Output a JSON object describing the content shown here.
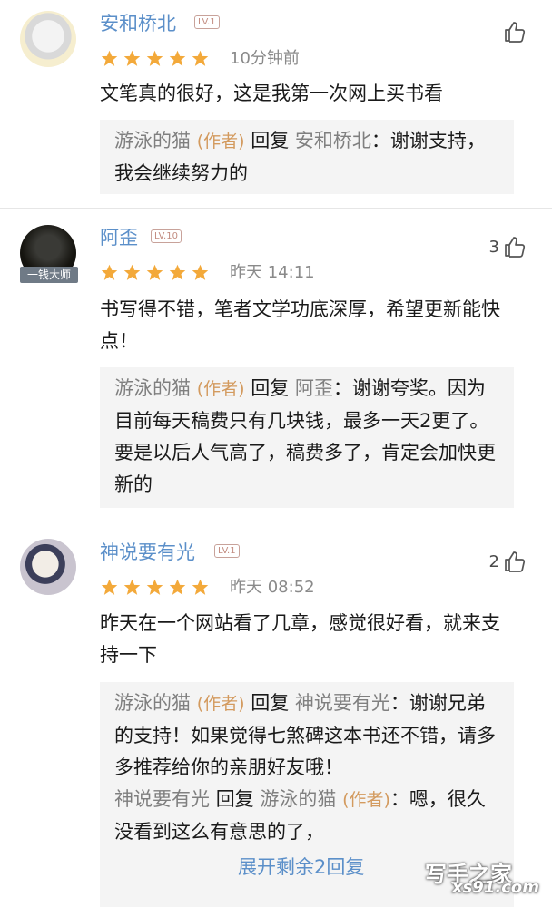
{
  "comments": [
    {
      "name": "安和桥北",
      "level": "LV.1",
      "time": "10分钟前",
      "likes": "",
      "rating": 5,
      "text": "文笔真的很好，这是我第一次网上买书看",
      "reply": {
        "replier": "游泳的猫",
        "author_tag": "(作者)",
        "action": "回复",
        "target": "安和桥北",
        "text": "：谢谢支持，我会继续努力的"
      }
    },
    {
      "name": "阿歪",
      "level": "LV.10",
      "time": "昨天 14:11",
      "likes": "3",
      "rating": 5,
      "avatar_badge": "一钱大师",
      "text": "书写得不错，笔者文学功底深厚，希望更新能快点！",
      "reply": {
        "replier": "游泳的猫",
        "author_tag": "(作者)",
        "action": "回复",
        "target": "阿歪",
        "text": "：谢谢夸奖。因为目前每天稿费只有几块钱，最多一天2更了。要是以后人气高了，稿费多了，肯定会加快更新的"
      }
    },
    {
      "name": "神说要有光",
      "level": "LV.1",
      "time": "昨天 08:52",
      "likes": "2",
      "rating": 5,
      "text": "昨天在一个网站看了几章，感觉很好看，就来支持一下",
      "reply": {
        "replier": "游泳的猫",
        "author_tag": "(作者)",
        "action": "回复",
        "target": "神说要有光",
        "text": "：谢谢兄弟的支持！如果觉得七煞碑这本书还不错，请多多推荐给你的亲朋好友哦！"
      },
      "reply2": {
        "replier": "神说要有光",
        "action": "回复",
        "target": "游泳的猫",
        "author_tag": "(作者)",
        "text": "：嗯，很久没看到这么有意思的了，"
      },
      "expand_label": "展开剩余2回复"
    }
  ],
  "watermark": {
    "line1": "写手之家",
    "line2": "xs91.com"
  },
  "colors": {
    "name": "#5b8fc9",
    "star": "#f3a93a",
    "author": "#d39a5e",
    "reply_bg": "#f4f4f4"
  }
}
